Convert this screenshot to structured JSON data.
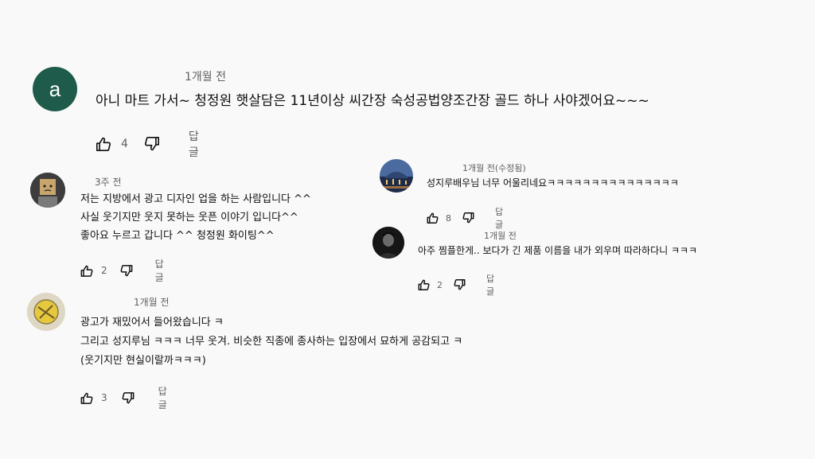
{
  "comments": [
    {
      "avatar_letter": "a",
      "avatar_color": "#1e5b4a",
      "time": "1개월 전",
      "lines": [
        "아니 마트 가서~ 청정원 햇살담은 11년이상 씨간장 숙성공법양조간장 골드 하나 사야겠어요~~~"
      ],
      "likes": "4",
      "reply": "답글"
    },
    {
      "avatar_icon": "boxhead-avatar",
      "time": "3주 전",
      "lines": [
        "저는  지방에서 광고 디자인 업을 하는 사람입니다 ^^",
        "사실 웃기지만  웃지 못하는 웃픈 이야기 입니다^^",
        "좋아요 누르고 갑니다 ^^  청정원 화이팅^^"
      ],
      "likes": "2",
      "reply": "답글"
    },
    {
      "avatar_icon": "sticker-avatar",
      "time": "1개월 전",
      "lines": [
        "광고가 재밌어서 들어왔습니다 ㅋ",
        "그리고 성지루님 ㅋㅋㅋ 너무 웃겨. 비슷한 직종에 종사하는 입장에서 묘하게 공감되고 ㅋ",
        "(웃기지만 현실이랄까ㅋㅋㅋ)"
      ],
      "likes": "3",
      "reply": "답글"
    },
    {
      "avatar_icon": "night-city-avatar",
      "time": "1개월 전(수정됨)",
      "lines": [
        "성지루배우님 너무 어울리네요ㅋㅋㅋㅋㅋㅋㅋㅋㅋㅋㅋㅋㅋㅋㅋ"
      ],
      "likes": "8",
      "reply": "답글"
    },
    {
      "avatar_icon": "person-dark-avatar",
      "time": "1개월 전",
      "lines": [
        "아주 찜플한게.. 보다가 긴 제품 이름을 내가 외우며 따라하다니 ㅋㅋㅋ"
      ],
      "likes": "2",
      "reply": "답글"
    }
  ]
}
